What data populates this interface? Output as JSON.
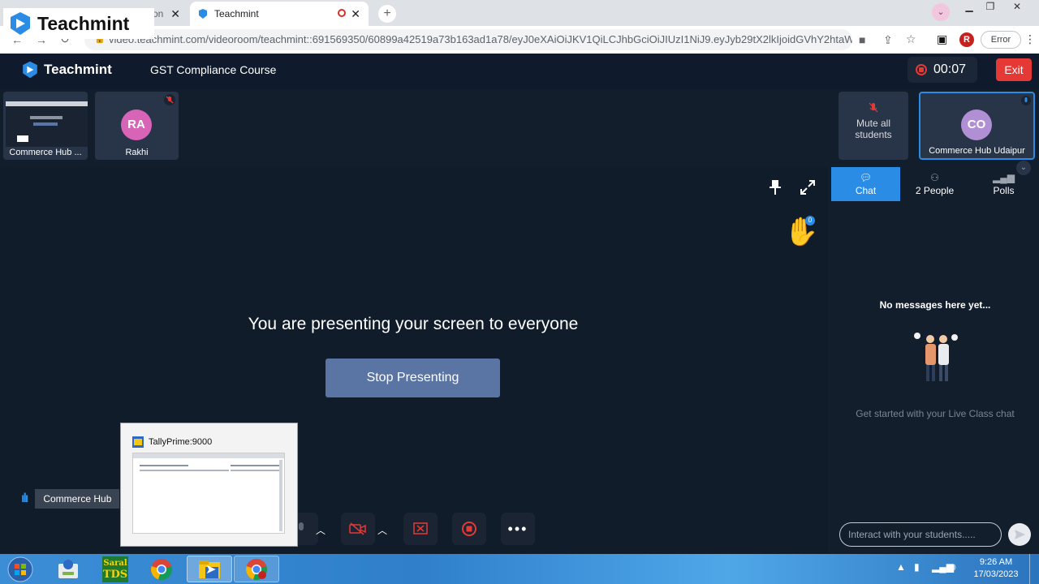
{
  "browser": {
    "tabs": [
      {
        "label": "on",
        "active": false
      },
      {
        "label": "Teachmint",
        "active": true
      }
    ],
    "new_tab_label": "+",
    "url": "video.teachmint.com/videoroom/teachmint::691569350/60899a42519a73b163ad1a78/eyJ0eXAiOiJKV1QiLCJhbGciOiJIUzI1NiJ9.eyJyb29tX2lkIjoidGVhY2htaW...",
    "profile_initial": "R",
    "error_label": "Error"
  },
  "watermark": {
    "brand": "Teachmint"
  },
  "header": {
    "brand": "Teachmint",
    "course_title": "GST Compliance Course",
    "timer": "00:07",
    "exit_label": "Exit"
  },
  "participants": [
    {
      "name": "Commerce Hub ...",
      "type": "screen"
    },
    {
      "name": "Rakhi",
      "initials": "RA",
      "avatar_color": "#d864b8",
      "muted": true
    },
    {
      "name": "Commerce Hub Udaipur",
      "initials": "CO",
      "avatar_color": "#b18fd4",
      "host": true
    }
  ],
  "mute_all": {
    "label": "Mute all students"
  },
  "stage": {
    "message": "You are presenting your screen to everyone",
    "stop_label": "Stop Presenting",
    "speaker_label": "Commerce Hub",
    "hand_count": "0"
  },
  "taskbar_thumbnail": {
    "title": "TallyPrime:9000"
  },
  "sidebar": {
    "tabs": [
      {
        "label": "Chat",
        "active": true
      },
      {
        "label": "2 People"
      },
      {
        "label": "Polls"
      }
    ],
    "empty_title": "No messages here yet...",
    "empty_subtitle": "Get started with your Live Class chat",
    "input_placeholder": "Interact with your students....."
  },
  "taskbar": {
    "time": "9:26 AM",
    "date": "17/03/2023",
    "saral_label_1": "Saral",
    "saral_label_2": "TDS"
  },
  "colors": {
    "accent": "#2b8ce6",
    "danger": "#e53935",
    "stop_button": "#5a74a4",
    "background": "#131e2d"
  }
}
